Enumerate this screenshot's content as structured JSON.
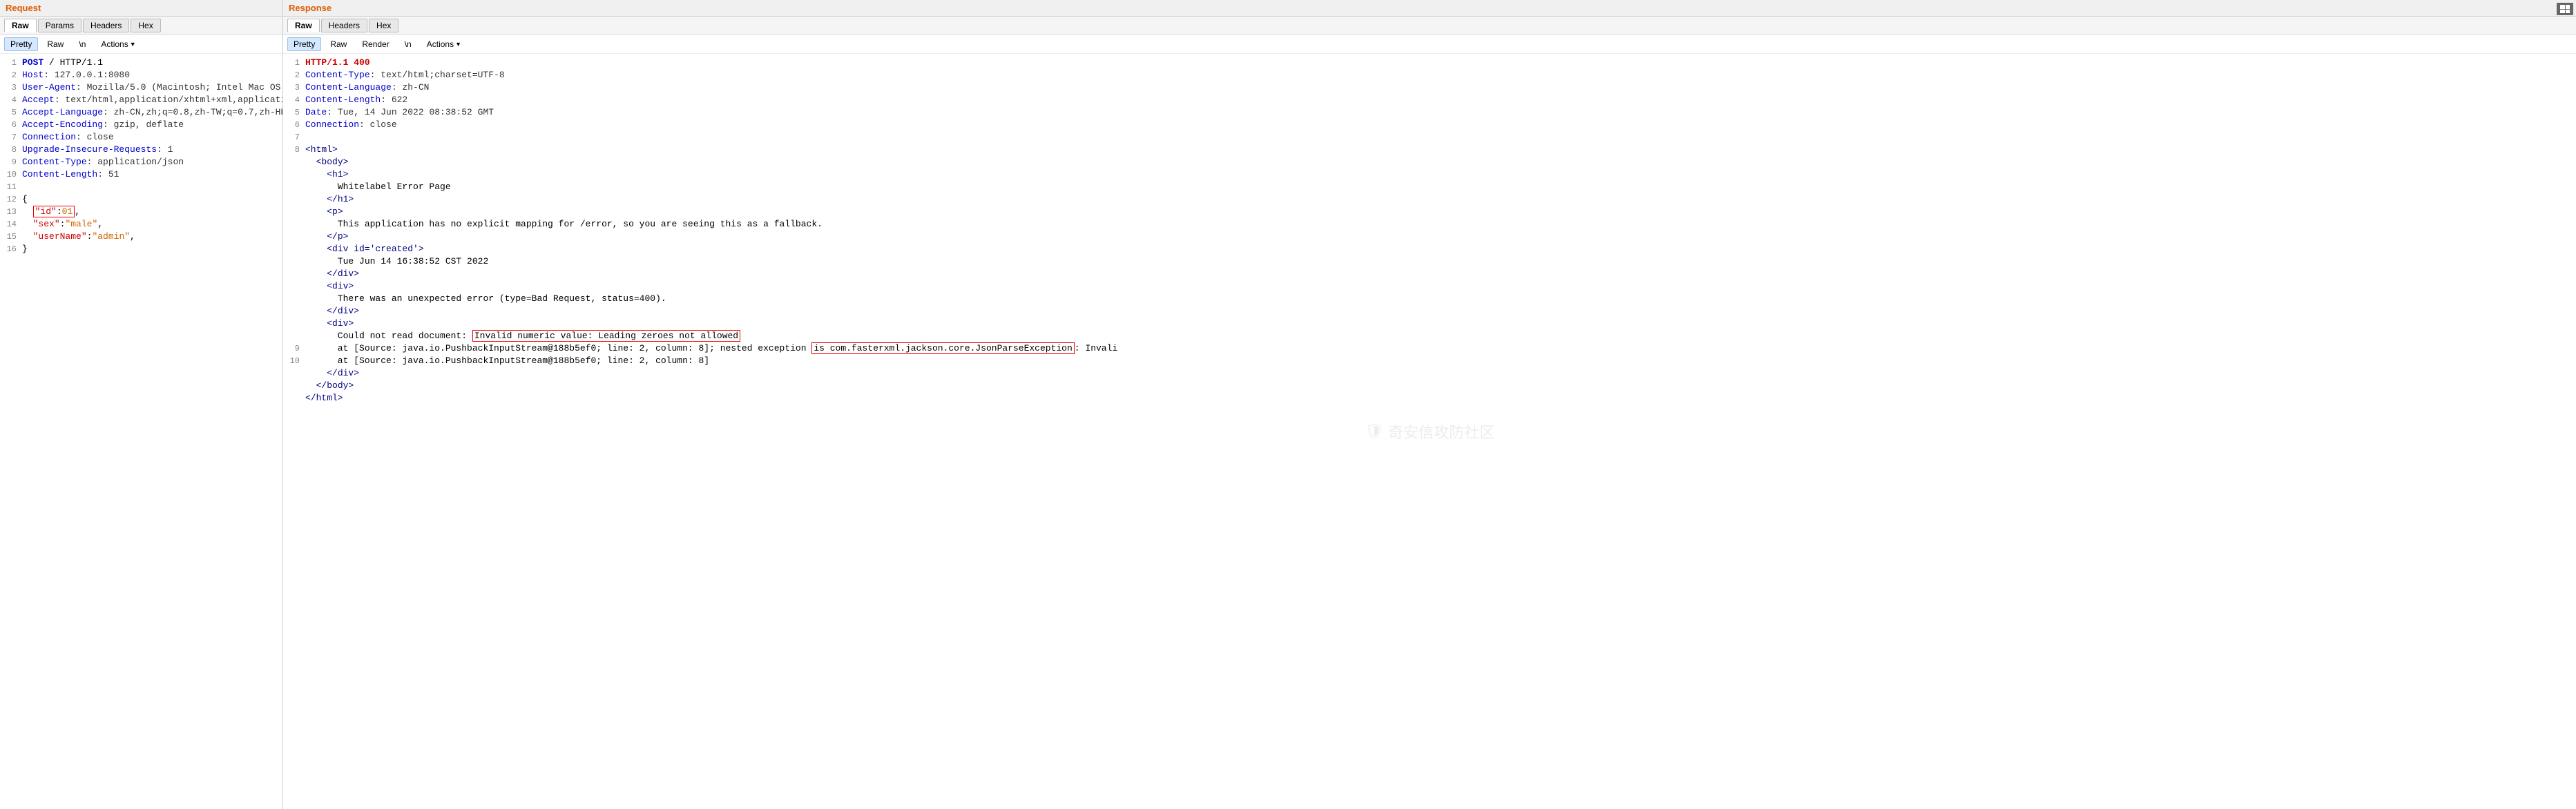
{
  "request": {
    "title": "Request",
    "tabs": [
      "Raw",
      "Params",
      "Headers",
      "Hex"
    ],
    "active_tab": "Raw",
    "toolbar": {
      "pretty_label": "Pretty",
      "raw_label": "Raw",
      "n_label": "\\n",
      "actions_label": "Actions"
    },
    "lines": [
      {
        "num": 1,
        "type": "method",
        "content": "POST / HTTP/1.1"
      },
      {
        "num": 2,
        "type": "header",
        "key": "Host",
        "val": " 127.0.0.1:8080"
      },
      {
        "num": 3,
        "type": "header",
        "key": "User-Agent",
        "val": " Mozilla/5.0 (Macintosh; Intel Mac OS"
      },
      {
        "num": 4,
        "type": "header",
        "key": "Accept",
        "val": " text/html,application/xhtml+xml,applicati"
      },
      {
        "num": 5,
        "type": "header",
        "key": "Accept-Language",
        "val": " zh-CN,zh;q=0.8,zh-TW;q=0.7,zh-HK"
      },
      {
        "num": 6,
        "type": "header",
        "key": "Accept-Encoding",
        "val": " gzip, deflate"
      },
      {
        "num": 7,
        "type": "header",
        "key": "Connection",
        "val": " close"
      },
      {
        "num": 8,
        "type": "header",
        "key": "Upgrade-Insecure-Requests",
        "val": " 1"
      },
      {
        "num": 9,
        "type": "header",
        "key": "Content-Type",
        "val": " application/json"
      },
      {
        "num": 10,
        "type": "header",
        "key": "Content-Length",
        "val": " 51"
      },
      {
        "num": 11,
        "type": "blank"
      },
      {
        "num": 12,
        "type": "plain",
        "content": "{"
      },
      {
        "num": 13,
        "type": "json-key-highlight",
        "content": "  \"id\":01,"
      },
      {
        "num": 14,
        "type": "json-kv",
        "key": "  \"sex\"",
        "val": "\"male\""
      },
      {
        "num": 15,
        "type": "json-kv",
        "key": "  \"userName\"",
        "val": "\"admin\""
      },
      {
        "num": 16,
        "type": "plain",
        "content": "}"
      }
    ]
  },
  "response": {
    "title": "Response",
    "tabs": [
      "Raw",
      "Headers",
      "Hex"
    ],
    "active_tab": "Raw",
    "toolbar": {
      "pretty_label": "Pretty",
      "raw_label": "Raw",
      "render_label": "Render",
      "n_label": "\\n",
      "actions_label": "Actions"
    },
    "lines": [
      {
        "num": 1,
        "type": "status",
        "content": "HTTP/1.1 400"
      },
      {
        "num": 2,
        "type": "header",
        "key": "Content-Type",
        "val": " text/html;charset=UTF-8"
      },
      {
        "num": 3,
        "type": "header",
        "key": "Content-Language",
        "val": " zh-CN"
      },
      {
        "num": 4,
        "type": "header",
        "key": "Content-Length",
        "val": " 622"
      },
      {
        "num": 5,
        "type": "header",
        "key": "Date",
        "val": " Tue, 14 Jun 2022 08:38:52 GMT"
      },
      {
        "num": 6,
        "type": "header",
        "key": "Connection",
        "val": " close"
      },
      {
        "num": 7,
        "type": "blank"
      },
      {
        "num": 8,
        "type": "html",
        "content": "<html>"
      },
      {
        "num": null,
        "type": "html",
        "content": "  <body>"
      },
      {
        "num": null,
        "type": "html",
        "content": "    <h1>"
      },
      {
        "num": null,
        "type": "html",
        "content": "      Whitelabel Error Page"
      },
      {
        "num": null,
        "type": "html",
        "content": "    </h1>"
      },
      {
        "num": null,
        "type": "html",
        "content": "    <p>"
      },
      {
        "num": null,
        "type": "html",
        "content": "      This application has no explicit mapping for /error, so you are seeing this as a fallback."
      },
      {
        "num": null,
        "type": "html",
        "content": "    </p>"
      },
      {
        "num": null,
        "type": "html",
        "content": "    <div id='created'>"
      },
      {
        "num": null,
        "type": "html",
        "content": "      Tue Jun 14 16:38:52 CST 2022"
      },
      {
        "num": null,
        "type": "html",
        "content": "    </div>"
      },
      {
        "num": null,
        "type": "html",
        "content": "    <div>"
      },
      {
        "num": null,
        "type": "html",
        "content": "      There was an unexpected error (type=Bad Request, status=400)."
      },
      {
        "num": null,
        "type": "html",
        "content": "    </div>"
      },
      {
        "num": null,
        "type": "html",
        "content": "    <div>"
      },
      {
        "num": null,
        "type": "html-highlight",
        "before": "      Could not read document: ",
        "highlight": "Invalid numeric value: Leading zeroes not allowed",
        "after": ""
      },
      {
        "num": 9,
        "type": "html",
        "content": "      at [Source: java.io.PushbackInputStream@188b5ef0; line: 2, column: 8]; nested exception "
      },
      {
        "num": 10,
        "type": "html",
        "content": "      at [Source: java.io.PushbackInputStream@188b5ef0; line: 2, column: 8]"
      },
      {
        "num": null,
        "type": "html",
        "content": "    </div>"
      },
      {
        "num": null,
        "type": "html",
        "content": "  </body>"
      },
      {
        "num": null,
        "type": "html",
        "content": "</html>"
      }
    ],
    "exception_highlight": "is com.fasterxml.jackson.core.JsonParseException",
    "watermark": "奇安信攻防社区"
  }
}
